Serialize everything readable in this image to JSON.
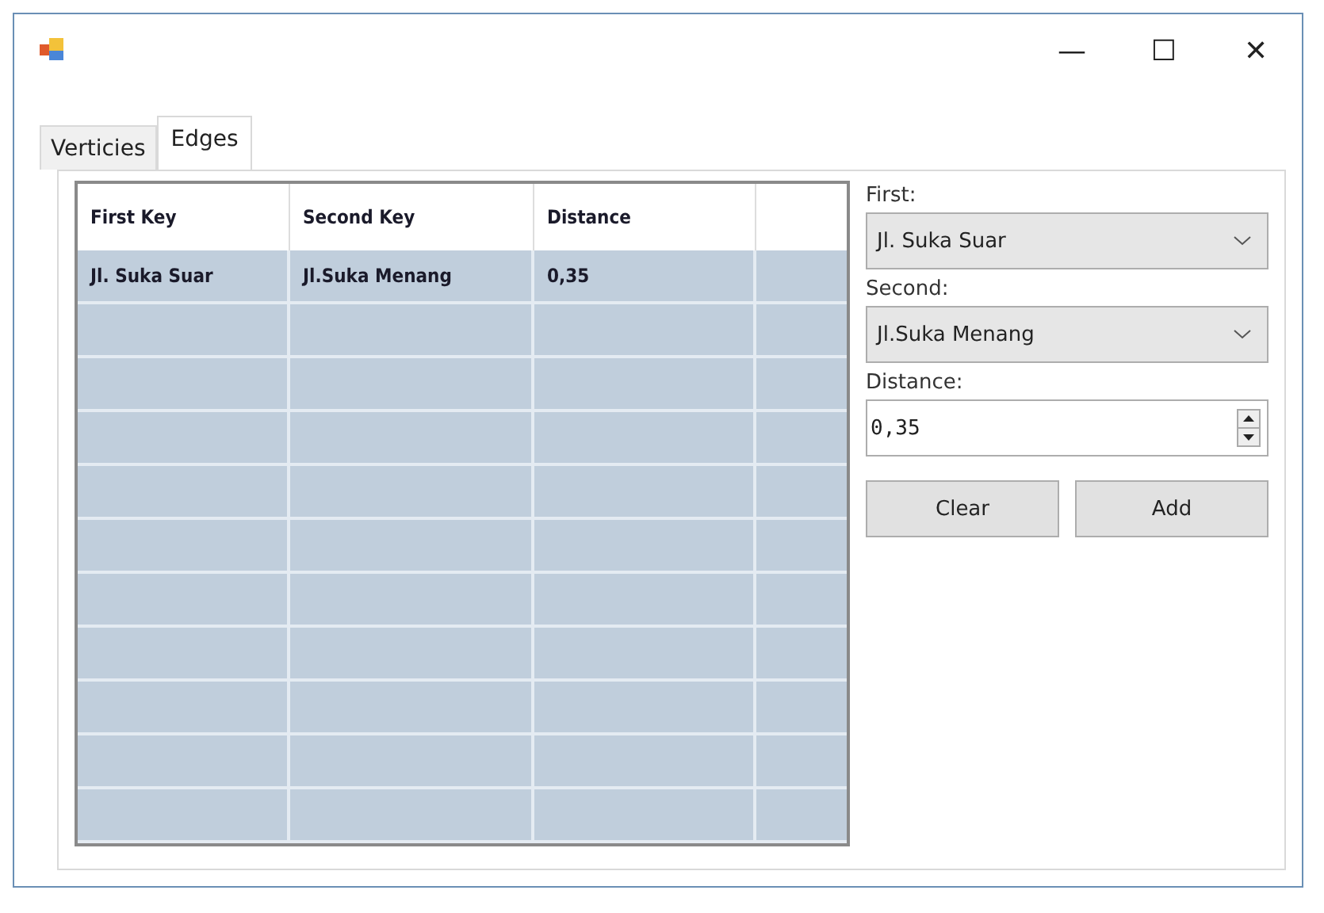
{
  "window": {
    "title_buttons": [
      "—",
      "☐",
      "✕"
    ]
  },
  "tabs": [
    {
      "label": "Verticies",
      "selected": false
    },
    {
      "label": "Edges",
      "selected": true
    }
  ],
  "table": {
    "columns": [
      "First Key",
      "Second Key",
      "Distance"
    ],
    "rows": [
      [
        "Jl. Suka Suar",
        "Jl.Suka Menang",
        "0,35"
      ]
    ]
  },
  "form": {
    "first": {
      "label": "First:",
      "value": "Jl. Suka Suar"
    },
    "second": {
      "label": "Second:",
      "value": "Jl.Suka Menang"
    },
    "distance": {
      "label": "Distance:",
      "value": "0,35"
    },
    "buttons": [
      "Clear",
      "Add"
    ]
  }
}
